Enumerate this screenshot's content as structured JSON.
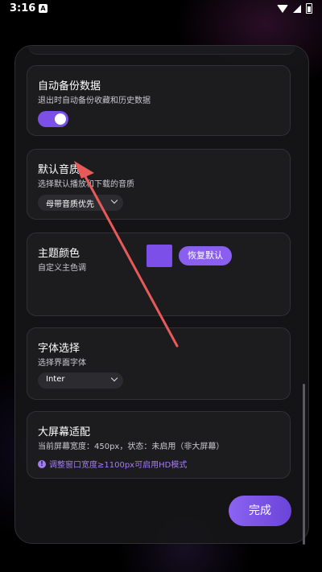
{
  "status_bar": {
    "time": "3:16",
    "notification_icon": "A"
  },
  "settings": {
    "auto_backup": {
      "title": "自动备份数据",
      "description": "退出时自动备份收藏和历史数据",
      "enabled": true
    },
    "audio_quality": {
      "title": "默认音质",
      "description": "选择默认播放和下载的音质",
      "selected": "母带音质优先"
    },
    "theme_color": {
      "title": "主题颜色",
      "description": "自定义主色调",
      "color": "#7b4fe8",
      "reset_label": "恢复默认"
    },
    "font": {
      "title": "字体选择",
      "description": "选择界面字体",
      "selected": "Inter"
    },
    "large_screen": {
      "title": "大屏幕适配",
      "description": "当前屏幕宽度：450px，状态：未启用（非大屏幕）",
      "hint": "调整窗口宽度≥1100px可启用HD模式"
    }
  },
  "done_label": "完成",
  "colors": {
    "accent": "#7b4fe8",
    "annotation": "#e85a5a"
  }
}
